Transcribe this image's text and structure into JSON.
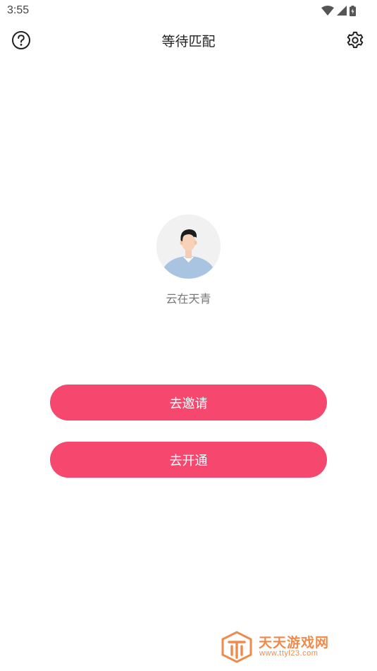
{
  "status_bar": {
    "time": "3:55",
    "icons": [
      "wifi-icon",
      "signal-icon",
      "battery-icon"
    ]
  },
  "header": {
    "title": "等待匹配",
    "left_icon": "help-circle-icon",
    "right_icon": "gear-icon"
  },
  "profile": {
    "avatar_icon": "default-avatar",
    "name": "云在天青"
  },
  "actions": {
    "invite_label": "去邀请",
    "open_label": "去开通"
  },
  "watermark": {
    "name": "天天游戏网",
    "url": "www.ttyl23.com"
  },
  "colors": {
    "button": "#f6476e",
    "background": "#ffffff",
    "username": "#777777",
    "watermark": "#f08a4b"
  }
}
